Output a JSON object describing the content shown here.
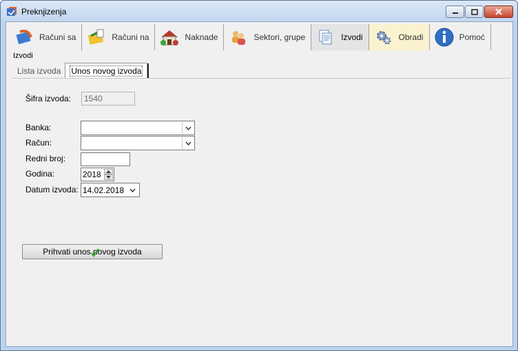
{
  "window": {
    "title": "Preknjizenja"
  },
  "toolbar": {
    "items": [
      {
        "label": "Računi sa",
        "icon": "outgoing-invoice-icon"
      },
      {
        "label": "Računi na",
        "icon": "incoming-invoice-icon"
      },
      {
        "label": "Naknade",
        "icon": "fees-house-icon"
      },
      {
        "label": "Sektori, grupe",
        "icon": "people-group-icon"
      },
      {
        "label": "Izvodi",
        "icon": "documents-icon"
      },
      {
        "label": "Obradi",
        "icon": "gears-icon"
      },
      {
        "label": "Pomoć",
        "icon": "info-icon"
      }
    ],
    "active": "Izvodi",
    "highlighted": "Obradi"
  },
  "section": {
    "label": "Izvodi"
  },
  "tabs": [
    {
      "label": "Lista izvoda",
      "active": false
    },
    {
      "label": "Unos novog izvoda",
      "active": true
    }
  ],
  "form": {
    "sifra_label": "Šifra izvoda:",
    "sifra_value": "1540",
    "banka_label": "Banka:",
    "banka_value": "",
    "racun_label": "Račun:",
    "racun_value": "",
    "redni_broj_label": "Redni broj:",
    "redni_broj_value": "",
    "godina_label": "Godina:",
    "godina_value": "2018",
    "datum_label": "Datum izvoda:",
    "datum_value": "14.02.2018",
    "submit_label": "Prihvati unos novog izvoda"
  },
  "colors": {
    "accent": "#bcd3ee",
    "highlight": "#fbf3cf",
    "checkmark": "#3aa53a"
  }
}
